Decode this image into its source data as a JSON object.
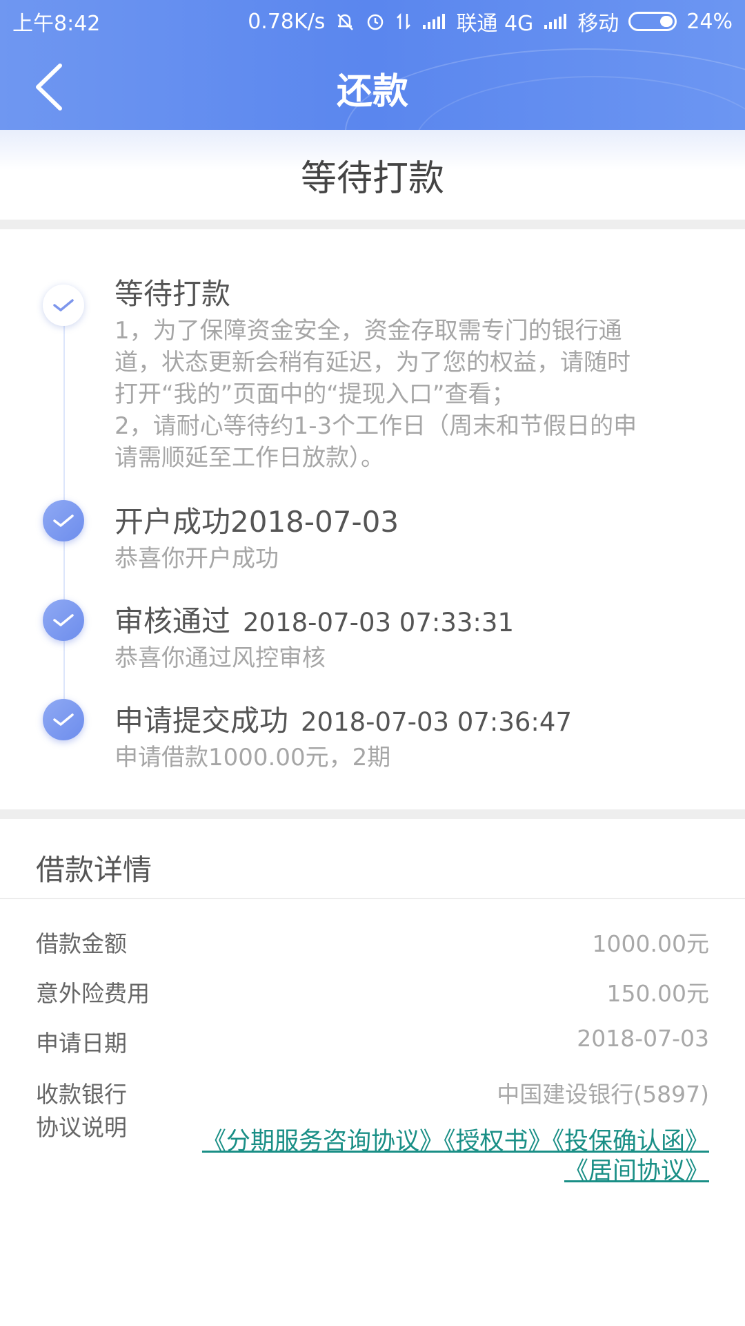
{
  "status_bar": {
    "time": "上午8:42",
    "speed": "0.78K/s",
    "carrier1": "联通 4G",
    "carrier2": "移动",
    "battery": "24%"
  },
  "nav": {
    "title": "还款"
  },
  "banner": {
    "status": "等待打款"
  },
  "timeline": [
    {
      "title": "等待打款",
      "date": "",
      "desc_lines": [
        "1，为了保障资金安全，资金存取需专门的银行通",
        "道，状态更新会稍有延迟，为了您的权益，请随时",
        "打开“我的”页面中的“提现入口”查看；",
        "2，请耐心等待约1-3个工作日（周末和节假日的申",
        "请需顺延至工作日放款）。"
      ]
    },
    {
      "title": "开户成功",
      "date": "2018-07-03",
      "desc": "恭喜你开户成功"
    },
    {
      "title": "审核通过",
      "date": "2018-07-03 07:33:31",
      "desc": "恭喜你通过风控审核"
    },
    {
      "title": "申请提交成功",
      "date": "2018-07-03 07:36:47",
      "desc": "申请借款1000.00元，2期"
    }
  ],
  "details": {
    "title": "借款详情",
    "rows": [
      {
        "label": "借款金额",
        "value": "1000.00元"
      },
      {
        "label": "意外险费用",
        "value": "150.00元"
      },
      {
        "label": "申请日期",
        "value": "2018-07-03"
      },
      {
        "label": "收款银行",
        "value": "中国建设银行(5897)"
      }
    ],
    "agreement_label": "协议说明",
    "agreements": [
      "《分期服务咨询协议》",
      "《授权书》",
      "《投保确认函》",
      "《居间协议》"
    ]
  },
  "colors": {
    "header": "#5a86ee",
    "link": "#1a8f86",
    "timeline_dot": "#7593ee"
  }
}
